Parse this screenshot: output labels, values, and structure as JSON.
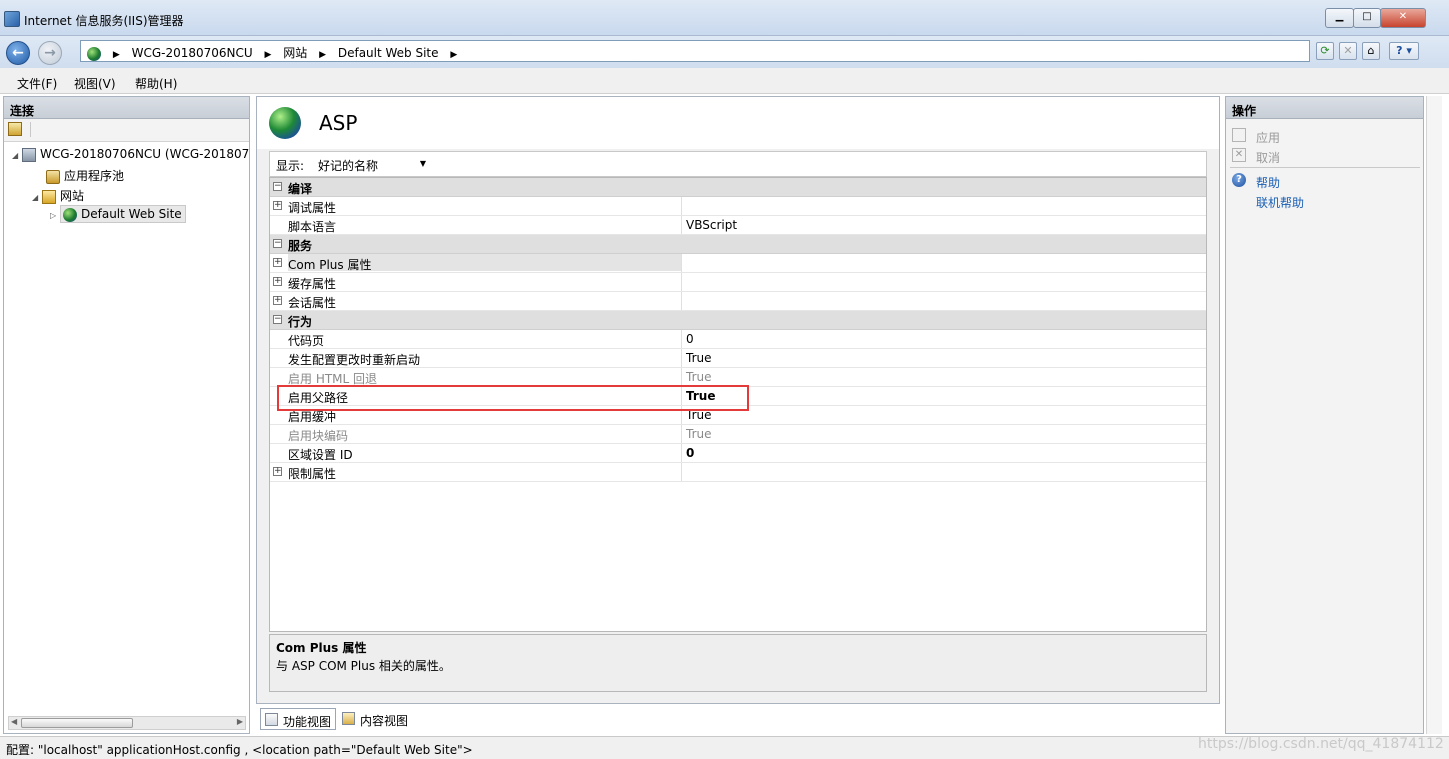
{
  "window": {
    "title": "Internet 信息服务(IIS)管理器"
  },
  "address": {
    "crumbs": [
      "WCG-20180706NCU",
      "网站",
      "Default Web Site"
    ]
  },
  "menu": [
    "文件(F)",
    "视图(V)",
    "帮助(H)"
  ],
  "connections": {
    "header": "连接",
    "tree": {
      "server": "WCG-20180706NCU (WCG-201807",
      "app_pools": "应用程序池",
      "sites": "网站",
      "site": "Default Web Site"
    }
  },
  "feature": {
    "title": "ASP",
    "display_label": "显示:",
    "display_value": "好记的名称",
    "rows": [
      {
        "type": "category",
        "expander": "⊟",
        "name": "编译"
      },
      {
        "type": "property",
        "expander": "⊞",
        "name": "调试属性",
        "value": ""
      },
      {
        "type": "property",
        "expander": "",
        "name": "脚本语言",
        "value": "VBScript"
      },
      {
        "type": "category",
        "expander": "⊟",
        "name": "服务"
      },
      {
        "type": "property",
        "expander": "⊞",
        "name": "Com Plus 属性",
        "value": "",
        "selected": true
      },
      {
        "type": "property",
        "expander": "⊞",
        "name": "缓存属性",
        "value": ""
      },
      {
        "type": "property",
        "expander": "⊞",
        "name": "会话属性",
        "value": ""
      },
      {
        "type": "category",
        "expander": "⊟",
        "name": "行为"
      },
      {
        "type": "property",
        "expander": "",
        "name": "代码页",
        "value": "0"
      },
      {
        "type": "property",
        "expander": "",
        "name": "发生配置更改时重新启动",
        "value": "True"
      },
      {
        "type": "property",
        "expander": "",
        "name": "启用 HTML 回退",
        "value": "True",
        "disabled": true
      },
      {
        "type": "property",
        "expander": "",
        "name": "启用父路径",
        "value": "True",
        "bold": true,
        "highlighted": true
      },
      {
        "type": "property",
        "expander": "",
        "name": "启用缓冲",
        "value": "True"
      },
      {
        "type": "property",
        "expander": "",
        "name": "启用块编码",
        "value": "True",
        "disabled": true
      },
      {
        "type": "property",
        "expander": "",
        "name": "区域设置 ID",
        "value": "0",
        "bold": true
      },
      {
        "type": "property",
        "expander": "⊞",
        "name": "限制属性",
        "value": ""
      }
    ],
    "description_title": "Com Plus 属性",
    "description_text": "与 ASP COM Plus 相关的属性。"
  },
  "view_tabs": {
    "features": "功能视图",
    "content": "内容视图"
  },
  "actions": {
    "header": "操作",
    "apply": "应用",
    "cancel": "取消",
    "help": "帮助",
    "online_help": "联机帮助"
  },
  "status": {
    "text": "配置: \"localhost\" applicationHost.config , <location path=\"Default Web Site\">"
  },
  "watermark": "https://blog.csdn.net/qq_41874112",
  "colors": {
    "highlight": "#e53a3a",
    "link": "#1a5fb4"
  }
}
